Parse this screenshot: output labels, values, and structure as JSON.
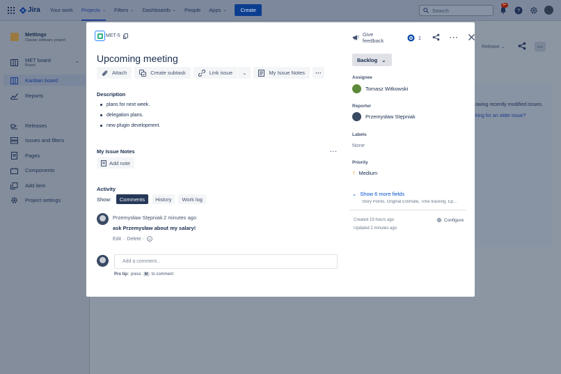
{
  "topnav": {
    "logo": "Jira",
    "items": [
      {
        "label": "Your work",
        "has_chevron": false
      },
      {
        "label": "Projects",
        "has_chevron": true,
        "active": true
      },
      {
        "label": "Filters",
        "has_chevron": true
      },
      {
        "label": "Dashboards",
        "has_chevron": true
      },
      {
        "label": "People",
        "has_chevron": false
      },
      {
        "label": "Apps",
        "has_chevron": true
      }
    ],
    "create_label": "Create",
    "search_placeholder": "Search",
    "notifications_badge": "9+"
  },
  "sidebar": {
    "project_name": "Mettings",
    "project_type": "Classic software project",
    "board_name": "MET board",
    "board_sub": "Board",
    "items": [
      {
        "label": "Kanban board",
        "icon": "board-icon",
        "active": true
      },
      {
        "label": "Reports",
        "icon": "reports-icon"
      },
      {
        "label": "Releases",
        "icon": "releases-icon"
      },
      {
        "label": "Issues and filters",
        "icon": "issues-icon"
      },
      {
        "label": "Pages",
        "icon": "pages-icon"
      },
      {
        "label": "Components",
        "icon": "components-icon"
      },
      {
        "label": "Add item",
        "icon": "add-item-icon"
      },
      {
        "label": "Project settings",
        "icon": "settings-icon"
      }
    ]
  },
  "background": {
    "release_label": "Release",
    "hint_text": "owing recently modified issues.",
    "hint_link": "king for an older issue?"
  },
  "issue": {
    "key": "MET-5",
    "title": "Upcoming meeting",
    "toolbar": {
      "attach": "Attach",
      "create_subtask": "Create subtask",
      "link_issue": "Link issue",
      "my_issue_notes": "My Issue Notes"
    },
    "header": {
      "give_feedback": "Give feedback",
      "watchers": "1"
    },
    "description_heading": "Description",
    "description_items": [
      "plans for next week.",
      "delegation plans.",
      "new plugin development."
    ],
    "notes_heading": "My Issue Notes",
    "add_note": "Add note",
    "activity_heading": "Activity",
    "show_label": "Show:",
    "activity_tabs": [
      "Comments",
      "History",
      "Work log"
    ],
    "comment": {
      "author": "Przemysław Stępniak",
      "time": "2 minutes ago",
      "body": "ask Przemysław about my salary!",
      "edit": "Edit",
      "delete": "Delete"
    },
    "add_comment_placeholder": "Add a comment...",
    "protip": {
      "label": "Pro tip:",
      "before": "press",
      "key": "M",
      "after": "to comment"
    }
  },
  "details": {
    "status": "Backlog",
    "assignee_label": "Assignee",
    "assignee": "Tomasz Witkowski",
    "reporter_label": "Reporter",
    "reporter": "Przemysław Stępniak",
    "labels_label": "Labels",
    "labels_value": "None",
    "priority_label": "Priority",
    "priority": "Medium",
    "more_fields": "Show 6 more fields",
    "more_fields_sub": "Story Points, Original Estimate, Time tracking, Ep...",
    "created": "Created 19 hours ago",
    "updated": "Updated 2 minutes ago",
    "configure": "Configure"
  }
}
